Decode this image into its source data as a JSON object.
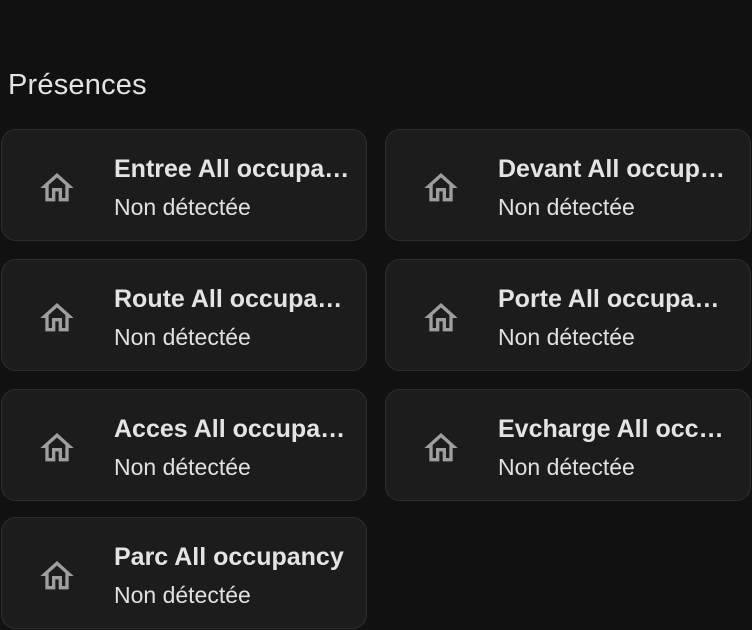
{
  "section": {
    "title": "Présences"
  },
  "cards": [
    {
      "name": "Entree All occupancy",
      "state": "Non détectée",
      "icon": "home-icon"
    },
    {
      "name": "Devant All occupancy",
      "state": "Non détectée",
      "icon": "home-icon"
    },
    {
      "name": "Route All occupancy",
      "state": "Non détectée",
      "icon": "home-icon"
    },
    {
      "name": "Porte All occupancy",
      "state": "Non détectée",
      "icon": "home-icon"
    },
    {
      "name": "Acces All occupancy",
      "state": "Non détectée",
      "icon": "home-icon"
    },
    {
      "name": "Evcharge All occupancy",
      "state": "Non détectée",
      "icon": "home-icon"
    },
    {
      "name": "Parc All occupancy",
      "state": "Non détectée",
      "icon": "home-icon"
    }
  ],
  "colors": {
    "background": "#111111",
    "card": "#1c1c1c",
    "card_border": "#2e2e2e",
    "icon": "#9e9e9e",
    "text": "#e1e1e1"
  }
}
